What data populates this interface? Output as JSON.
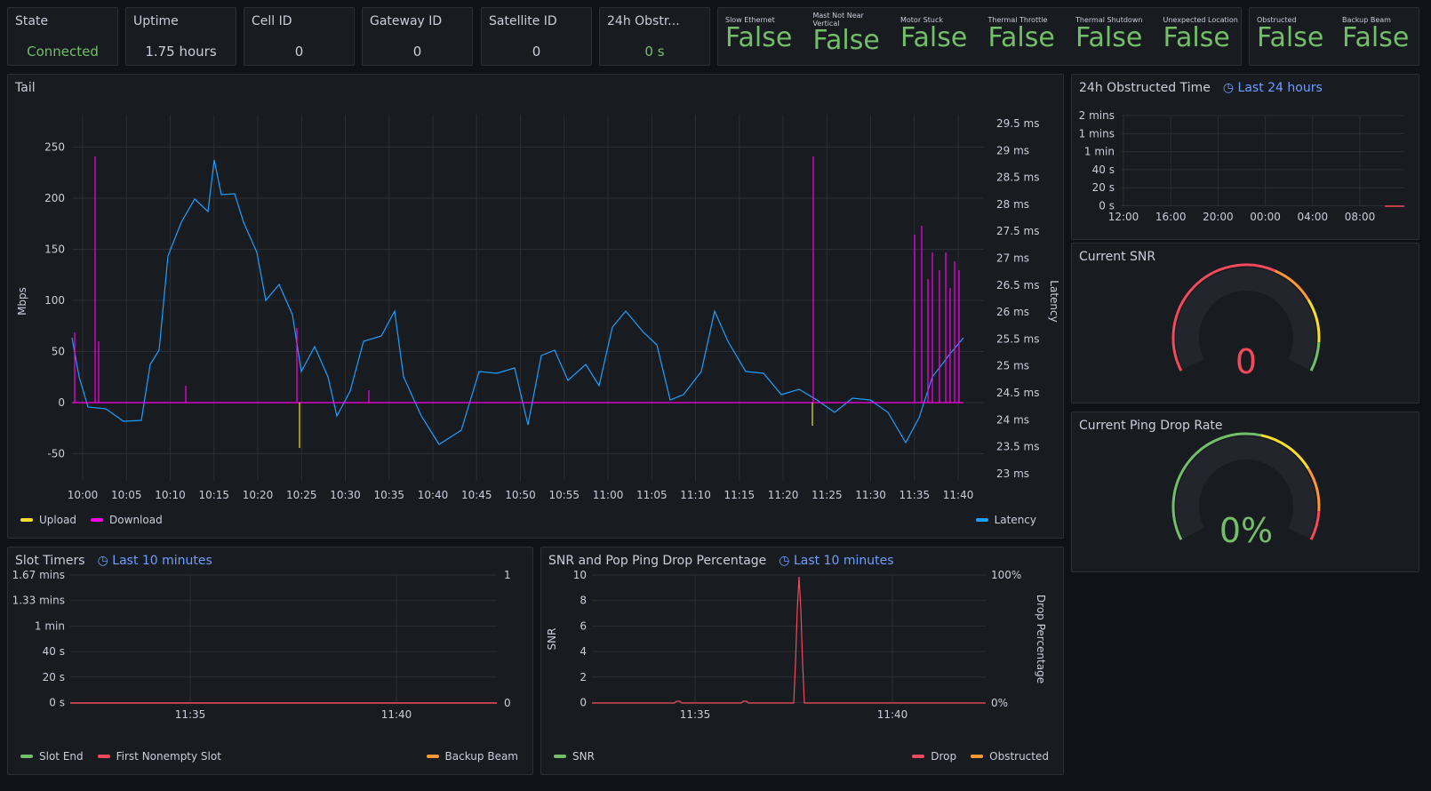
{
  "stats": [
    {
      "title": "State",
      "value": "Connected",
      "color": "green"
    },
    {
      "title": "Uptime",
      "value": "1.75 hours",
      "color": "white"
    },
    {
      "title": "Cell ID",
      "value": "0",
      "color": "white"
    },
    {
      "title": "Gateway ID",
      "value": "0",
      "color": "white"
    },
    {
      "title": "Satellite ID",
      "value": "0",
      "color": "white"
    },
    {
      "title": "24h Obstr...",
      "value": "0 s",
      "color": "green"
    }
  ],
  "alerts": [
    {
      "label": "Slow Ethernet",
      "value": "False"
    },
    {
      "label": "Mast Not Near Vertical",
      "value": "False"
    },
    {
      "label": "Motor Stuck",
      "value": "False"
    },
    {
      "label": "Thermal Throttle",
      "value": "False"
    },
    {
      "label": "Thermal Shutdown",
      "value": "False"
    },
    {
      "label": "Unexpected Location",
      "value": "False"
    }
  ],
  "alerts2": [
    {
      "label": "Obstructed",
      "value": "False"
    },
    {
      "label": "Backup Beam",
      "value": "False"
    }
  ],
  "tail": {
    "title": "Tail",
    "ylabel": "Mbps",
    "y2label": "Latency",
    "yticks": [
      "250",
      "200",
      "150",
      "100",
      "50",
      "0",
      "-50"
    ],
    "y2ticks": [
      "29.5 ms",
      "29 ms",
      "28.5 ms",
      "28 ms",
      "27.5 ms",
      "27 ms",
      "26.5 ms",
      "26 ms",
      "25.5 ms",
      "25 ms",
      "24.5 ms",
      "24 ms",
      "23.5 ms",
      "23 ms"
    ],
    "xticks": [
      "10:00",
      "10:05",
      "10:10",
      "10:15",
      "10:20",
      "10:25",
      "10:30",
      "10:35",
      "10:40",
      "10:45",
      "10:50",
      "10:55",
      "11:00",
      "11:05",
      "11:10",
      "11:15",
      "11:20",
      "11:25",
      "11:30",
      "11:35",
      "11:40"
    ],
    "legend_left": [
      {
        "name": "Upload",
        "color": "#fade2a"
      },
      {
        "name": "Download",
        "color": "#ff00ea"
      }
    ],
    "legend_right": [
      {
        "name": "Latency",
        "color": "#1f9fff"
      }
    ]
  },
  "obstructed": {
    "title": "24h Obstructed Time",
    "range": "Last 24 hours",
    "yticks": [
      "2 mins",
      "1 mins",
      "1 min",
      "40 s",
      "20 s",
      "0 s"
    ],
    "xticks": [
      "12:00",
      "16:00",
      "20:00",
      "00:00",
      "04:00",
      "08:00"
    ]
  },
  "snr_gauge": {
    "title": "Current SNR",
    "value": "0",
    "color": "#f2495c"
  },
  "ping_gauge": {
    "title": "Current Ping Drop Rate",
    "value": "0%",
    "color": "#73bf69"
  },
  "slot": {
    "title": "Slot Timers",
    "range": "Last 10 minutes",
    "yticks": [
      "1.67 mins",
      "1.33 mins",
      "1 min",
      "40 s",
      "20 s",
      "0 s"
    ],
    "y2ticks": [
      "1",
      "0"
    ],
    "xticks": [
      "11:35",
      "11:40"
    ],
    "legend_left": [
      {
        "name": "Slot End",
        "color": "#73bf69"
      },
      {
        "name": "First Nonempty Slot",
        "color": "#f2495c"
      }
    ],
    "legend_right": [
      {
        "name": "Backup Beam",
        "color": "#ff9830"
      }
    ]
  },
  "snrdrop": {
    "title": "SNR and Pop Ping Drop Percentage",
    "range": "Last 10 minutes",
    "ylabel": "SNR",
    "y2label": "Drop Percentage",
    "yticks": [
      "10",
      "8",
      "6",
      "4",
      "2",
      "0"
    ],
    "y2ticks": [
      "100%",
      "0%"
    ],
    "xticks": [
      "11:35",
      "11:40"
    ],
    "legend_left": [
      {
        "name": "SNR",
        "color": "#73bf69"
      }
    ],
    "legend_right": [
      {
        "name": "Drop",
        "color": "#f2495c"
      },
      {
        "name": "Obstructed",
        "color": "#ff9830"
      }
    ]
  }
}
